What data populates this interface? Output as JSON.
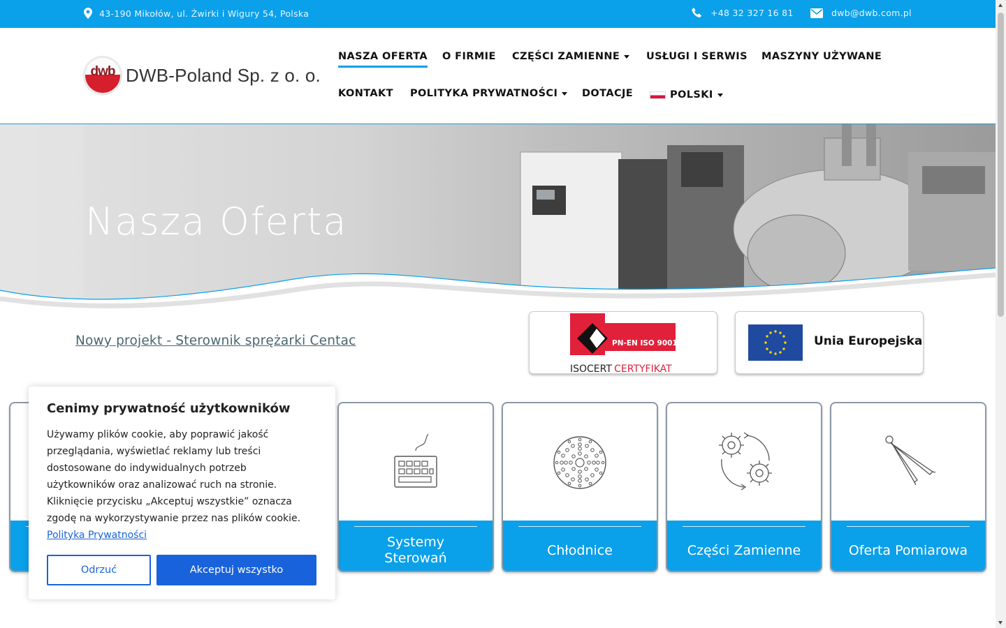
{
  "topbar": {
    "address": "43-190 Mikołów, ul. Żwirki i Wigury 54, Polska",
    "phone": "+48 32 327 16 81",
    "email": "dwb@dwb.com.pl"
  },
  "header": {
    "logo_mark": "dwb",
    "logo_text": "DWB-Poland Sp. z  o. o.",
    "nav": [
      {
        "label": "NASZA OFERTA",
        "active": true
      },
      {
        "label": "O FIRMIE"
      },
      {
        "label": "CZĘŚCI ZAMIENNE",
        "dropdown": true
      },
      {
        "label": "USŁUGI I SERWIS"
      },
      {
        "label": "MASZYNY UŻYWANE"
      },
      {
        "label": "KONTAKT"
      },
      {
        "label": "POLITYKA PRYWATNOŚCI",
        "dropdown": true
      },
      {
        "label": "DOTACJE"
      },
      {
        "label": "POLSKI",
        "dropdown": true,
        "icon": "poland-flag-icon"
      }
    ]
  },
  "hero": {
    "title": "Nasza Oferta"
  },
  "news_link": "Nowy projekt - Sterownik sprężarki Centac",
  "badges": {
    "iso": {
      "top": "PN-EN ISO 9001",
      "bottom_black": "ISOCERT",
      "bottom_red": "CERTYFIKAT"
    },
    "eu": {
      "label": "Unia Europejska"
    }
  },
  "cards": [
    {
      "label": "",
      "icon": "hidden-icon"
    },
    {
      "label": "Systemy Sterowań",
      "icon": "keyboard-icon"
    },
    {
      "label": "Chłodnice",
      "icon": "perforated-disc-icon"
    },
    {
      "label": "Części Zamienne",
      "icon": "gears-cycle-icon"
    },
    {
      "label": "Oferta Pomiarowa",
      "icon": "compass-icon"
    }
  ],
  "cookie": {
    "title": "Cenimy prywatność użytkowników",
    "text": "Używamy plików cookie, aby poprawić jakość przeglądania, wyświetlać reklamy lub treści dostosowane do indywidualnych potrzeb użytkowników oraz analizować ruch na stronie. Kliknięcie przycisku „Akceptuj wszystkie” oznacza zgodę na wykorzystywanie przez nas plików cookie.",
    "policy_link": "Polityka Prywatności",
    "reject": "Odrzuć",
    "accept": "Akceptuj wszystko"
  },
  "colors": {
    "accent": "#0aa0ea",
    "cookie_button": "#1863dc",
    "logo_red": "#d61f2c",
    "eu_blue": "#1f4a9f"
  }
}
